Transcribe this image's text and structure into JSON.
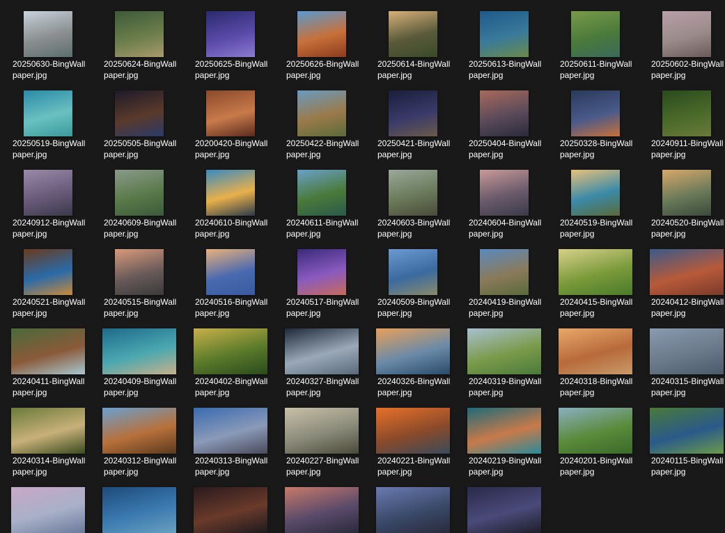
{
  "files": [
    {
      "line1": "20250630-BingWall",
      "line2": "paper.jpg",
      "colors": [
        "#c8d2dc",
        "#8a8f8e",
        "#5c6e70"
      ]
    },
    {
      "line1": "20250624-BingWall",
      "line2": "paper.jpg",
      "colors": [
        "#3d5a3a",
        "#6b7d4a",
        "#a89a6e"
      ]
    },
    {
      "line1": "20250625-BingWall",
      "line2": "paper.jpg",
      "colors": [
        "#2a2a6e",
        "#5a4aa8",
        "#8a7ad0"
      ]
    },
    {
      "line1": "20250626-BingWall",
      "line2": "paper.jpg",
      "colors": [
        "#5a9ad0",
        "#c8703a",
        "#8a3a1e"
      ]
    },
    {
      "line1": "20250614-BingWall",
      "line2": "paper.jpg",
      "colors": [
        "#d8b07a",
        "#5a5a3a",
        "#3a4a2a"
      ]
    },
    {
      "line1": "20250613-BingWall",
      "line2": "paper.jpg",
      "colors": [
        "#1e5a8a",
        "#3a7a9a",
        "#6a8a4a"
      ]
    },
    {
      "line1": "20250611-BingWall",
      "line2": "paper.jpg",
      "colors": [
        "#7a9a4a",
        "#4a7a3a",
        "#3a6a5a"
      ]
    },
    {
      "line1": "20250602-BingWall",
      "line2": "paper.jpg",
      "colors": [
        "#b8a0a8",
        "#9a8a8a",
        "#6a5a5a"
      ]
    },
    {
      "line1": "20250519-BingWall",
      "line2": "paper.jpg",
      "colors": [
        "#2a8aa8",
        "#6ac0c0",
        "#3a9a9a"
      ]
    },
    {
      "line1": "20250505-BingWall",
      "line2": "paper.jpg",
      "colors": [
        "#1e1a2a",
        "#5a3a2a",
        "#2a3a6a"
      ]
    },
    {
      "line1": "20200420-BingWall",
      "line2": "paper.jpg",
      "colors": [
        "#8a4a2a",
        "#c87a4a",
        "#5a2a1e"
      ]
    },
    {
      "line1": "20250422-BingWall",
      "line2": "paper.jpg",
      "colors": [
        "#6a9ac0",
        "#9a7a4a",
        "#5a6a3a"
      ]
    },
    {
      "line1": "20250421-BingWall",
      "line2": "paper.jpg",
      "colors": [
        "#1a1e3a",
        "#3a3a6a",
        "#6a5a4a"
      ]
    },
    {
      "line1": "20250404-BingWall",
      "line2": "paper.jpg",
      "colors": [
        "#a86a5a",
        "#5a4a5a",
        "#2a2a3a"
      ]
    },
    {
      "line1": "20250328-BingWall",
      "line2": "paper.jpg",
      "colors": [
        "#2a3a5a",
        "#4a5a8a",
        "#c8703a"
      ]
    },
    {
      "line1": "20240911-BingWall",
      "line2": "paper.jpg",
      "colors": [
        "#2a4a1e",
        "#4a6a2a",
        "#6a7a3a"
      ]
    },
    {
      "line1": "20240912-BingWall",
      "line2": "paper.jpg",
      "colors": [
        "#9a8aa8",
        "#6a5a7a",
        "#3a3a4a"
      ]
    },
    {
      "line1": "20240609-BingWall",
      "line2": "paper.jpg",
      "colors": [
        "#8a9a8a",
        "#5a7a4a",
        "#3a5a3a"
      ]
    },
    {
      "line1": "20240610-BingWall",
      "line2": "paper.jpg",
      "colors": [
        "#3a8ac0",
        "#e8b04a",
        "#2a3a4a"
      ]
    },
    {
      "line1": "20240611-BingWall",
      "line2": "paper.jpg",
      "colors": [
        "#6aa0c8",
        "#4a7a3a",
        "#2a5a4a"
      ]
    },
    {
      "line1": "20240603-BingWall",
      "line2": "paper.jpg",
      "colors": [
        "#9aa89a",
        "#6a7a5a",
        "#4a4a3a"
      ]
    },
    {
      "line1": "20240604-BingWall",
      "line2": "paper.jpg",
      "colors": [
        "#c89a9a",
        "#6a5a6a",
        "#3a3a4a"
      ]
    },
    {
      "line1": "20240519-BingWall",
      "line2": "paper.jpg",
      "colors": [
        "#e8c07a",
        "#3a8aa8",
        "#5a6a3a"
      ]
    },
    {
      "line1": "20240520-BingWall",
      "line2": "paper.jpg",
      "colors": [
        "#d8a86a",
        "#6a7a5a",
        "#3a4a3a"
      ]
    },
    {
      "line1": "20240521-BingWall",
      "line2": "paper.jpg",
      "colors": [
        "#6a3a1e",
        "#2a6aa8",
        "#c88a3a"
      ]
    },
    {
      "line1": "20240515-BingWall",
      "line2": "paper.jpg",
      "colors": [
        "#d89a7a",
        "#6a5a5a",
        "#3a3a3a"
      ]
    },
    {
      "line1": "20240516-BingWall",
      "line2": "paper.jpg",
      "colors": [
        "#e8b07a",
        "#4a6ab0",
        "#3a5aa0"
      ]
    },
    {
      "line1": "20240517-BingWall",
      "line2": "paper.jpg",
      "colors": [
        "#3a2a7a",
        "#8a5ac0",
        "#c86a5a"
      ]
    },
    {
      "line1": "20240509-BingWall",
      "line2": "paper.jpg",
      "colors": [
        "#6a9ad0",
        "#3a6aa0",
        "#8a8a6a"
      ]
    },
    {
      "line1": "20240419-BingWall",
      "line2": "paper.jpg",
      "colors": [
        "#5a8ac0",
        "#8a7a5a",
        "#5a6a3a"
      ]
    },
    {
      "line1": "20240415-BingWall",
      "line2": "paper.jpg",
      "colors": [
        "#d8d08a",
        "#7a9a3a",
        "#4a7a2a"
      ]
    },
    {
      "line1": "20240412-BingWall",
      "line2": "paper.jpg",
      "colors": [
        "#3a5a8a",
        "#b85a3a",
        "#7a3a2a"
      ]
    },
    {
      "line1": "20240411-BingWall",
      "line2": "paper.jpg",
      "colors": [
        "#4a6a3a",
        "#8a5a3a",
        "#a8c8d0"
      ]
    },
    {
      "line1": "20240409-BingWall",
      "line2": "paper.jpg",
      "colors": [
        "#1e6a8a",
        "#4aa8b0",
        "#c8b08a"
      ]
    },
    {
      "line1": "20240402-BingWall",
      "line2": "paper.jpg",
      "colors": [
        "#c8b04a",
        "#5a7a2a",
        "#2a4a1e"
      ]
    },
    {
      "line1": "20240327-BingWall",
      "line2": "paper.jpg",
      "colors": [
        "#1e2a3a",
        "#9aa8b8",
        "#5a6a7a"
      ]
    },
    {
      "line1": "20240326-BingWall",
      "line2": "paper.jpg",
      "colors": [
        "#e8a05a",
        "#6a8aa8",
        "#2a4a6a"
      ]
    },
    {
      "line1": "20240319-BingWall",
      "line2": "paper.jpg",
      "colors": [
        "#a8c0d0",
        "#7a9a4a",
        "#4a7a3a"
      ]
    },
    {
      "line1": "20240318-BingWall",
      "line2": "paper.jpg",
      "colors": [
        "#e8a86a",
        "#b86a3a",
        "#c89a6a"
      ]
    },
    {
      "line1": "20240315-BingWall",
      "line2": "paper.jpg",
      "colors": [
        "#8a9ab0",
        "#6a7a8a",
        "#4a5a6a"
      ]
    },
    {
      "line1": "20240314-BingWall",
      "line2": "paper.jpg",
      "colors": [
        "#6a7a3a",
        "#c8b07a",
        "#3a4a1e"
      ]
    },
    {
      "line1": "20240312-BingWall",
      "line2": "paper.jpg",
      "colors": [
        "#6aa0d0",
        "#b8703a",
        "#5a3a1e"
      ]
    },
    {
      "line1": "20240313-BingWall",
      "line2": "paper.jpg",
      "colors": [
        "#3a6ab0",
        "#8a9ab8",
        "#4a4a5a"
      ]
    },
    {
      "line1": "20240227-BingWall",
      "line2": "paper.jpg",
      "colors": [
        "#c8c0a8",
        "#8a8a7a",
        "#4a4a3a"
      ]
    },
    {
      "line1": "20240221-BingWall",
      "line2": "paper.jpg",
      "colors": [
        "#e8702a",
        "#8a4a2a",
        "#3a4a5a"
      ]
    },
    {
      "line1": "20240219-BingWall",
      "line2": "paper.jpg",
      "colors": [
        "#1e6a7a",
        "#c87a4a",
        "#2a8a9a"
      ]
    },
    {
      "line1": "20240201-BingWall",
      "line2": "paper.jpg",
      "colors": [
        "#8ab0c0",
        "#5a8a3a",
        "#3a6a2a"
      ]
    },
    {
      "line1": "20240115-BingWall",
      "line2": "paper.jpg",
      "colors": [
        "#4a7a3a",
        "#2a5a8a",
        "#6a9a4a"
      ]
    },
    {
      "line1": "",
      "line2": "",
      "colors": [
        "#c8a8c8",
        "#a8b0c8",
        "#6a7a9a"
      ]
    },
    {
      "line1": "",
      "line2": "",
      "colors": [
        "#1e4a7a",
        "#3a7ab0",
        "#6aa0c0"
      ]
    },
    {
      "line1": "",
      "line2": "",
      "colors": [
        "#2a1a1e",
        "#6a3a2a",
        "#1e1a1e"
      ]
    },
    {
      "line1": "",
      "line2": "",
      "colors": [
        "#c87a6a",
        "#5a4a6a",
        "#2a2a3a"
      ]
    },
    {
      "line1": "",
      "line2": "",
      "colors": [
        "#6a7ab0",
        "#3a4a6a",
        "#2a2a3a"
      ]
    },
    {
      "line1": "",
      "line2": "",
      "colors": [
        "#2a2a4a",
        "#4a4a7a",
        "#1e1e2a"
      ]
    }
  ]
}
